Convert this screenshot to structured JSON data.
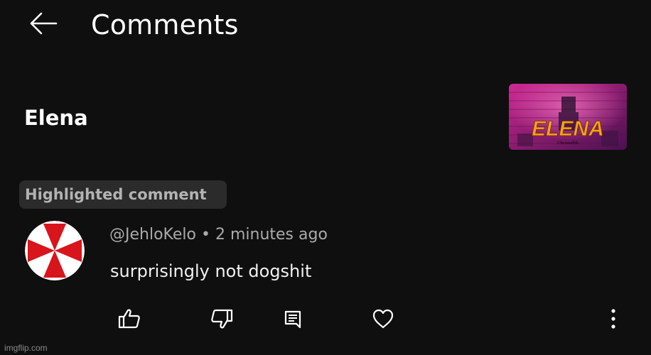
{
  "header": {
    "back_icon": "arrow-left-icon",
    "title": "Comments"
  },
  "video": {
    "title": "Elena",
    "thumbnail": {
      "title_art": "ELENA",
      "subtitle_art": "Chromolith"
    }
  },
  "highlighted_badge": "Highlighted comment",
  "comment": {
    "avatar_icon": "red-cross-avatar",
    "handle": "@JehloKelo",
    "separator": "•",
    "time": "2 minutes ago",
    "text": "surprisingly not dogshit"
  },
  "actions": [
    {
      "name": "like",
      "icon": "thumbs-up-icon"
    },
    {
      "name": "dislike",
      "icon": "thumbs-down-icon"
    },
    {
      "name": "reply",
      "icon": "comment-icon"
    },
    {
      "name": "heart",
      "icon": "heart-icon"
    },
    {
      "name": "more",
      "icon": "more-vertical-icon"
    }
  ],
  "watermark": "imgflip.com",
  "colors": {
    "background": "#0f0f0f",
    "text_primary": "#ffffff",
    "text_secondary": "#aaaaaa",
    "badge_bg": "#2b2b2b",
    "avatar_red": "#d8141c",
    "thumb_title": "#f3a51c"
  }
}
